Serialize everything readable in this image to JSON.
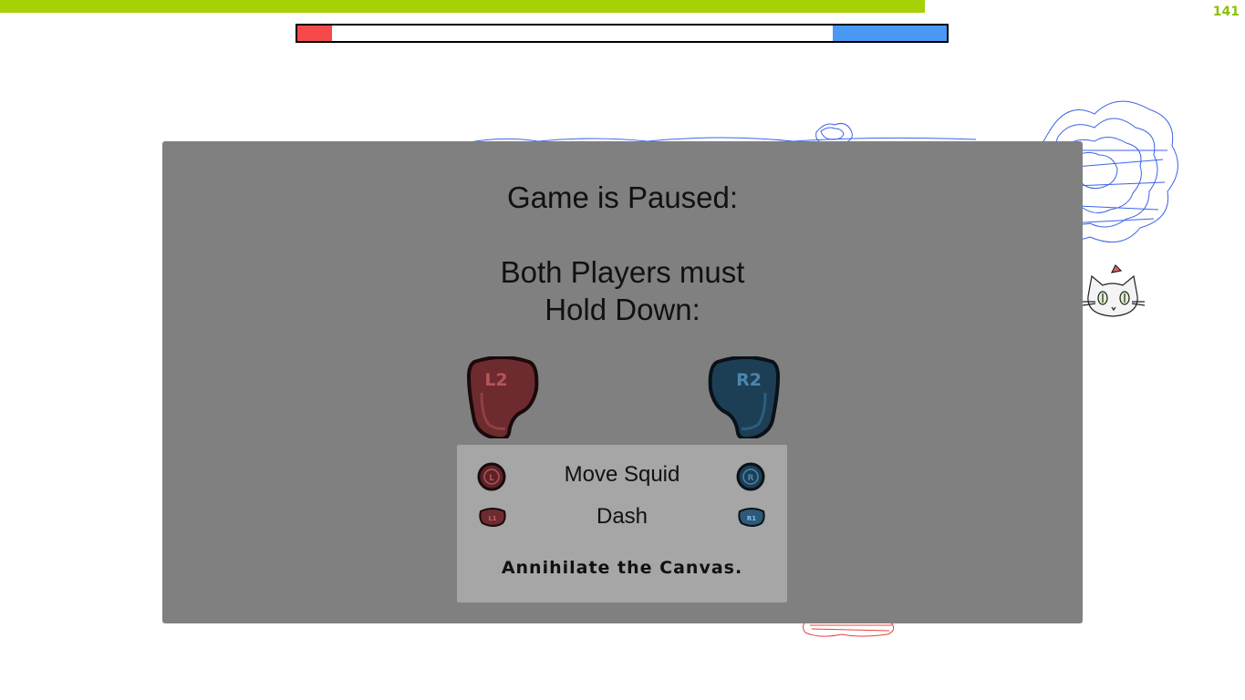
{
  "hud": {
    "counter": "141",
    "timer_fraction": 0.743,
    "score": {
      "red_fraction": 0.053,
      "blue_fraction": 0.176
    },
    "colors": {
      "timer": "#a6d205",
      "red_team": "#f44a4a",
      "blue_team": "#4b98f4"
    }
  },
  "pause_menu": {
    "title": "Game is Paused:",
    "hold_line1": "Both Players must",
    "hold_line2": "Hold Down:",
    "triggers": {
      "left": "L2",
      "right": "R2"
    },
    "controls": [
      {
        "left_icon": "L",
        "action": "Move Squid",
        "right_icon": "R"
      },
      {
        "left_icon": "L1",
        "action": "Dash",
        "right_icon": "R1"
      }
    ],
    "tagline": "Annihilate the Canvas."
  },
  "background": {
    "icons": [
      "cat-icon",
      "blue-paint-scribble",
      "red-paint-scribble"
    ]
  }
}
